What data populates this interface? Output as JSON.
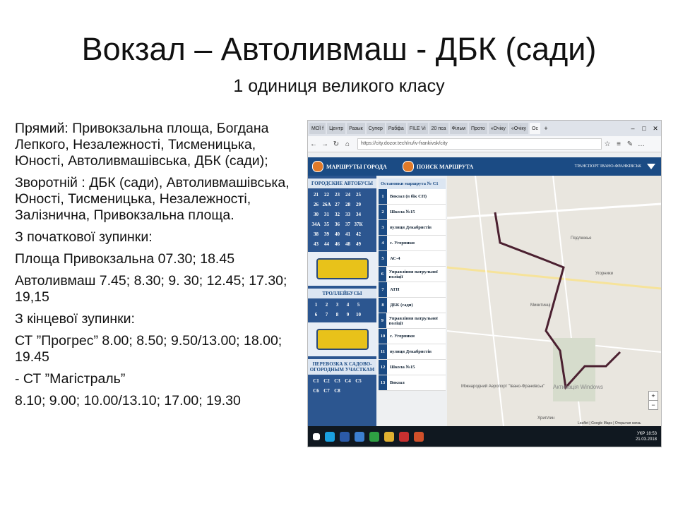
{
  "title": "Вокзал – Автоливмаш - ДБК (сади)",
  "subtitle": "1 одиниця великого класу",
  "body": {
    "p1": "Прямий: Привокзальна площа, Богдана Лепкого, Незалежності, Тисменицька, Юності, Автоливмашівська, ДБК (сади);",
    "p2": "Зворотній : ДБК (сади), Автоливмашівська, Юності, Тисменицька, Незалежності, Залізнична, Привокзальна площа.",
    "p3": "З початкової зупинки:",
    "p4": "Площа Привокзальна 07.30; 18.45",
    "p5": "Автоливмаш 7.45; 8.30; 9. 30; 12.45; 17.30; 19,15",
    "p6": "З кінцевої зупинки:",
    "p7": "СТ ”Прогрес” 8.00; 8.50; 9.50/13.00; 18.00; 19.45",
    "p8": "- СТ ”Магістраль”",
    "p9": "8.10; 9.00; 10.00/13.10; 17.00; 19.30"
  },
  "browser": {
    "tabs": [
      "МОЇ f",
      "Центр",
      "Разык",
      "Супер",
      "Рабфа",
      "FILE Vi",
      "20 пса",
      "Фільм",
      "Прото",
      "«Очіку",
      "«Очіку",
      "Ос"
    ],
    "url": "https://city.dozor.tech/ru/iv-frankivsk/city"
  },
  "site": {
    "routes_label": "МАРШРУТЫ ГОРОДА",
    "search_label": "ПОИСК МАРШРУТА",
    "brand": "ТРАНСПОРТ ІВАНО-ФРАНКІВСЬК",
    "buses_head": "ГОРОДСКИЕ АВТОБУСЫ",
    "bus_numbers": [
      "21",
      "22",
      "23",
      "24",
      "25",
      "26",
      "26А",
      "27",
      "28",
      "29",
      "30",
      "31",
      "32",
      "33",
      "34",
      "34А",
      "35",
      "36",
      "37",
      "37К",
      "38",
      "39",
      "40",
      "41",
      "42",
      "43",
      "44",
      "46",
      "48",
      "49"
    ],
    "trolley_head": "ТРОЛЛЕЙБУСЫ",
    "trolley_numbers": [
      "1",
      "2",
      "3",
      "4",
      "5",
      "6",
      "7",
      "8",
      "9",
      "10"
    ],
    "garden_head": "ПЕРЕВОЗКА К САДОВО-ОГОРОДНЫМ УЧАСТКАМ",
    "garden_numbers": [
      "С1",
      "С2",
      "С3",
      "С4",
      "С5",
      "С6",
      "С7",
      "С8"
    ],
    "stops_head": "Остановки маршрута № С1",
    "stops": [
      "Вокзал (в бік СП)",
      "Школа №15",
      "вулиця Декабристів",
      "с. Угорники",
      "АС-4",
      "Управління патрульної поліції",
      "АТП",
      "ДБК (сади)",
      "Управління патрульної поліції",
      "с. Угорники",
      "вулиця Декабристів",
      "Школа №15",
      "Вокзал"
    ]
  },
  "map": {
    "labels": [
      "Подлюжье",
      "Угорники",
      "Микитинці",
      "Міжнародний Аеропорт \"Івано-Франківськ\"",
      "Хриплин",
      "Активація Windows",
      "Leaflet | Google Maps | Открытая связь"
    ]
  },
  "taskbar": {
    "time": "18:53",
    "date": "21.03.2018",
    "lang": "УКР"
  }
}
